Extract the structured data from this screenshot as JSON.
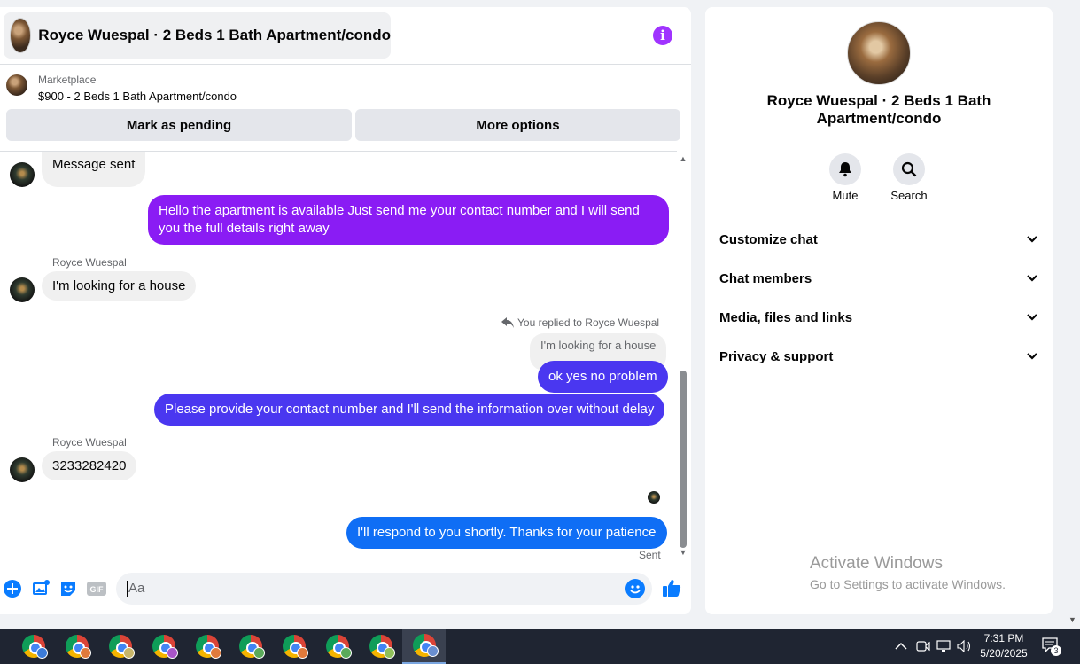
{
  "header": {
    "title": "Royce Wuespal · 2 Beds 1 Bath Apartment/condo"
  },
  "listing": {
    "label": "Marketplace",
    "price_title": "$900 - 2 Beds 1 Bath Apartment/condo",
    "mark_pending_label": "Mark as pending",
    "more_options_label": "More options"
  },
  "messages": {
    "msg1": "Message sent",
    "msg2": "Hello the apartment is available Just send me your contact number and I will send you the full details right away",
    "sender1": "Royce Wuespal",
    "msg3": "I'm looking for a house",
    "replied_label": "You replied to Royce Wuespal",
    "quoted": "I'm looking for a house",
    "msg4": "ok yes no problem",
    "msg5": "Please provide your contact number and I'll send the information over without delay",
    "sender2": "Royce Wuespal",
    "msg6": "3233282420",
    "msg7": "I'll respond to you shortly. Thanks for your patience",
    "sent_status": "Sent"
  },
  "composer": {
    "placeholder": "Aa"
  },
  "info_panel": {
    "title": "Royce Wuespal · 2 Beds 1 Bath Apartment/condo",
    "mute_label": "Mute",
    "search_label": "Search",
    "sections": [
      "Customize chat",
      "Chat members",
      "Media, files and links",
      "Privacy & support"
    ]
  },
  "watermark": {
    "title": "Activate Windows",
    "subtitle": "Go to Settings to activate Windows."
  },
  "taskbar": {
    "time": "7:31 PM",
    "date": "5/20/2025",
    "notification_count": "3"
  },
  "colors": {
    "purple": "#8a1cf4",
    "indigo": "#4a37f0",
    "blue": "#0f6ef5",
    "messenger_accent": "#0a7cff"
  }
}
